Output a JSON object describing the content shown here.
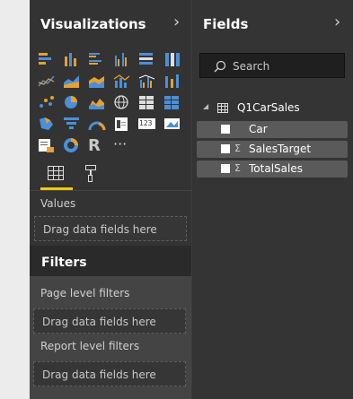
{
  "viz": {
    "title": "Visualizations",
    "chevron": "›"
  },
  "fields_panel": {
    "title": "Fields",
    "chevron": "›"
  },
  "search": {
    "placeholder": "Search"
  },
  "tabs": [
    {
      "name": "Fields"
    },
    {
      "name": "Format"
    }
  ],
  "values": {
    "label": "Values",
    "drop": "Drag data fields here"
  },
  "filters": {
    "title": "Filters",
    "page": {
      "label": "Page level filters",
      "drop": "Drag data fields here"
    },
    "report": {
      "label": "Report level filters",
      "drop": "Drag data fields here"
    }
  },
  "table": {
    "name": "Q1CarSales",
    "fields": [
      {
        "label": "Car",
        "sigma": false
      },
      {
        "label": "SalesTarget",
        "sigma": true
      },
      {
        "label": "TotalSales",
        "sigma": true
      }
    ]
  },
  "icons": [
    "stacked-bar-icon",
    "stacked-column-icon",
    "clustered-bar-icon",
    "clustered-column-icon",
    "100pct-bar-icon",
    "100pct-column-icon",
    "line-icon",
    "area-icon",
    "stacked-area-icon",
    "line-column-icon",
    "line-clustered-icon",
    "ribbon-icon",
    "waterfall-icon",
    "scatter-icon",
    "pie-icon",
    "donut-chart-icon",
    "treemap-icon",
    "map-icon",
    "filled-map-icon",
    "funnel-icon",
    "gauge-icon",
    "card-icon",
    "multirow-card-icon",
    "kpi-icon",
    "slicer-icon",
    "donut-icon",
    "r-visual-icon",
    "more-icon"
  ],
  "more_glyph": "···"
}
